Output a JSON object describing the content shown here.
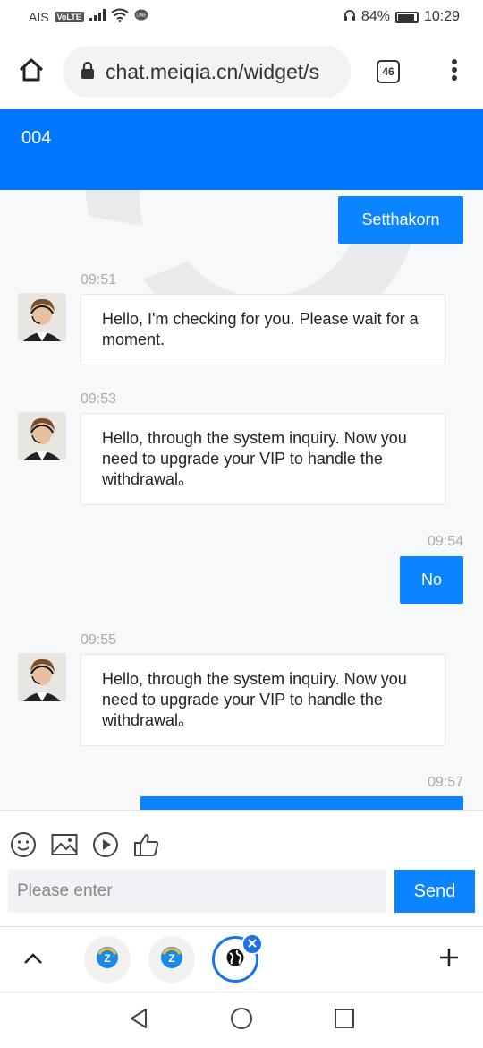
{
  "status_bar": {
    "carrier": "AIS",
    "volte": "VoLTE",
    "battery": "84%",
    "battery_level": 0.84,
    "time": "10:29"
  },
  "browser": {
    "url": "chat.meiqia.cn/widget/s",
    "tab_count": "46"
  },
  "chat": {
    "title": "004",
    "messages": [
      {
        "from": "user",
        "text": "Setthakorn"
      },
      {
        "from": "agent",
        "time": "09:51",
        "text": "Hello, I'm checking for you. Please wait for a moment."
      },
      {
        "from": "agent",
        "time": "09:53",
        "text": "Hello, through the system inquiry. Now you need to upgrade your VIP to handle the withdrawal。"
      },
      {
        "from": "user",
        "time": "09:54",
        "text": "No"
      },
      {
        "from": "agent",
        "time": "09:55",
        "text": "Hello, through the system inquiry. Now you need to upgrade your VIP to handle the withdrawal。"
      },
      {
        "from": "user",
        "time": "09:57",
        "text": ""
      }
    ]
  },
  "composer": {
    "placeholder": "Please enter",
    "send_label": "Send",
    "tools": [
      "emoji-icon",
      "image-icon",
      "video-icon",
      "thumbs-up-icon"
    ]
  },
  "colors": {
    "brand_blue": "#0076ff",
    "bubble_blue": "#0a84ff",
    "tab_active": "#1a73e8"
  }
}
